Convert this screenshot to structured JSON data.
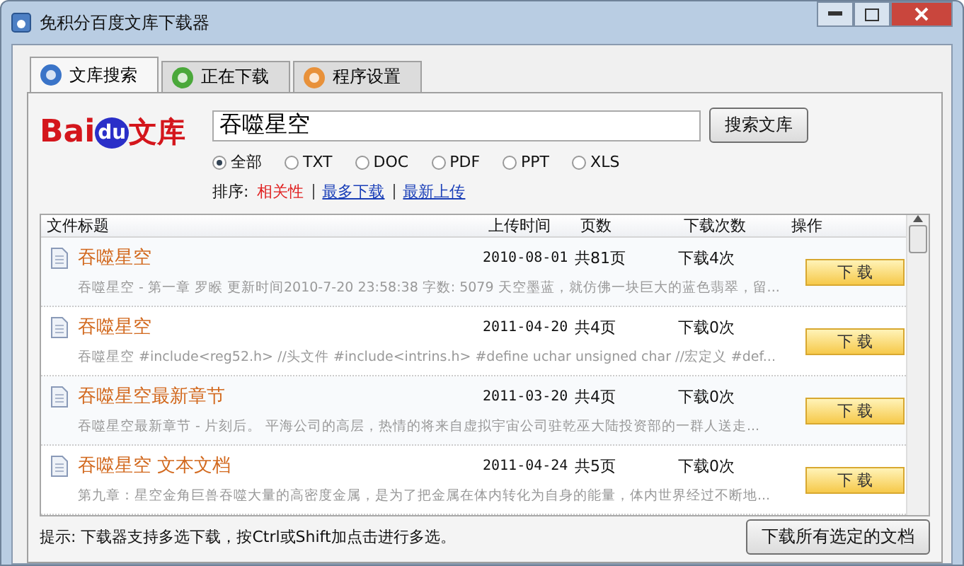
{
  "window": {
    "title": "免积分百度文库下载器"
  },
  "tabs": [
    {
      "label": "文库搜索",
      "selected": true
    },
    {
      "label": "正在下载",
      "selected": false
    },
    {
      "label": "程序设置",
      "selected": false
    }
  ],
  "logo": {
    "latin_a": "Bai",
    "latin_b": "du",
    "cjk": "文库"
  },
  "search": {
    "value": "吞噬星空",
    "button": "搜索文库"
  },
  "file_types": [
    {
      "label": "全部",
      "selected": true
    },
    {
      "label": "TXT",
      "selected": false
    },
    {
      "label": "DOC",
      "selected": false
    },
    {
      "label": "PDF",
      "selected": false
    },
    {
      "label": "PPT",
      "selected": false
    },
    {
      "label": "XLS",
      "selected": false
    }
  ],
  "sort": {
    "label": "排序:",
    "options": [
      {
        "label": "相关性",
        "selected": true
      },
      {
        "label": "最多下载",
        "selected": false
      },
      {
        "label": "最新上传",
        "selected": false
      }
    ]
  },
  "table": {
    "columns": [
      "文件标题",
      "上传时间",
      "页数",
      "下载次数",
      "操作"
    ],
    "rows": [
      {
        "title": "吞噬星空",
        "date": "2010-08-01",
        "pages": "共81页",
        "downloads": "下载4次",
        "description": "吞噬星空 - 第一章 罗睺 更新时间2010-7-20 23:58:38 字数: 5079 天空墨蓝，就仿佛一块巨大的蓝色翡翠，留...",
        "action": "下 载"
      },
      {
        "title": "吞噬星空",
        "date": "2011-04-20",
        "pages": "共4页",
        "downloads": "下载0次",
        "description": "吞噬星空 #include<reg52.h> //头文件 #include<intrins.h> #define uchar unsigned char //宏定义 #def...",
        "action": "下 载"
      },
      {
        "title": "吞噬星空最新章节",
        "date": "2011-03-20",
        "pages": "共4页",
        "downloads": "下载0次",
        "description": "吞噬星空最新章节 - 片刻后。 平海公司的高层，热情的将来自虚拟宇宙公司驻乾巫大陆投资部的一群人送走...",
        "action": "下 载"
      },
      {
        "title": "吞噬星空 文本文档",
        "date": "2011-04-24",
        "pages": "共5页",
        "downloads": "下载0次",
        "description": "第九章：星空金角巨兽吞噬大量的高密度金属，是为了把金属在体内转化为自身的能量，体内世界经过不断地...",
        "action": "下 载"
      }
    ]
  },
  "status_bar": {
    "hint": "提示: 下载器支持多选下载，按Ctrl或Shift加点击进行多选。",
    "button": "下载所有选定的文档"
  }
}
